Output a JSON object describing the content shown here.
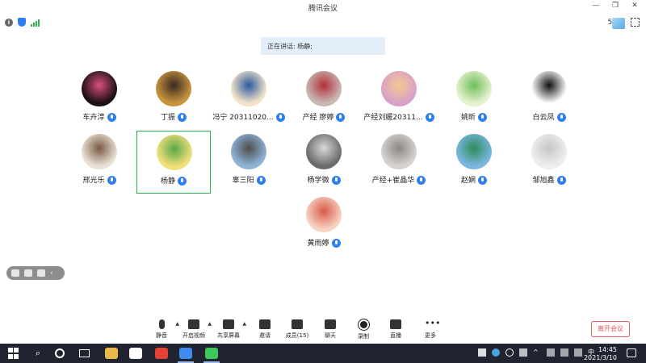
{
  "window": {
    "title": "腾讯会议",
    "controls": [
      "—",
      "❐",
      "✕"
    ]
  },
  "infobar": {
    "network_label": "56",
    "icons": [
      "info-icon",
      "shield-icon",
      "signal-icon"
    ]
  },
  "speaking": {
    "text": "正在讲话: 杨静;"
  },
  "participants": [
    {
      "name": "车卉淳",
      "avatar_color": "#1a0f14",
      "avatar_accent": "#d94f7a"
    },
    {
      "name": "丁振",
      "avatar_color": "#c8953e",
      "avatar_accent": "#3a2a22"
    },
    {
      "name": "冯宁 20311020...",
      "avatar_color": "#f2e3c9",
      "avatar_accent": "#2c5aa0"
    },
    {
      "name": "产经 廖婷",
      "avatar_color": "#c9b9b4",
      "avatar_accent": "#b2303a"
    },
    {
      "name": "产经刘媛20311...",
      "avatar_color": "#d9a0c9",
      "avatar_accent": "#f2c98f"
    },
    {
      "name": "姚昕",
      "avatar_color": "#e6f1cf",
      "avatar_accent": "#6dbf5c"
    },
    {
      "name": "白云凤",
      "avatar_color": "#ffffff",
      "avatar_accent": "#111111"
    },
    {
      "name": "邢光乐",
      "avatar_color": "#e9e1d6",
      "avatar_accent": "#7a5a44"
    },
    {
      "name": "杨静",
      "avatar_color": "#f4e07a",
      "avatar_accent": "#59a84a"
    },
    {
      "name": "辜三阳",
      "avatar_color": "#8fb4d8",
      "avatar_accent": "#4d4d4d"
    },
    {
      "name": "杨学微",
      "avatar_color": "#6b6b6b",
      "avatar_accent": "#d9d9d9"
    },
    {
      "name": "产经+崔晶华",
      "avatar_color": "#d6d3d0",
      "avatar_accent": "#8a8784"
    },
    {
      "name": "赵娴",
      "avatar_color": "#7ab6e0",
      "avatar_accent": "#2e8b57"
    },
    {
      "name": "邹旭鑫",
      "avatar_color": "#eeeeee",
      "avatar_accent": "#c6c6c6"
    },
    {
      "name": "黄雨婷",
      "avatar_color": "#f7d2c1",
      "avatar_accent": "#d8594a"
    }
  ],
  "active_speaker_index": 8,
  "toolbar": [
    {
      "label": "静音",
      "icon": "mic-icon",
      "caret": true
    },
    {
      "label": "开启视频",
      "icon": "camera-off-icon",
      "caret": true
    },
    {
      "label": "共享屏幕",
      "icon": "share-screen-icon",
      "caret": true
    },
    {
      "label": "邀请",
      "icon": "invite-icon",
      "caret": false
    },
    {
      "label": "成员(15)",
      "icon": "members-icon",
      "caret": false
    },
    {
      "label": "聊天",
      "icon": "chat-icon",
      "caret": false
    },
    {
      "label": "录制",
      "icon": "record-icon",
      "caret": false
    },
    {
      "label": "直播",
      "icon": "live-icon",
      "caret": false
    },
    {
      "label": "更多",
      "icon": "more-icon",
      "caret": false
    }
  ],
  "leave_button": "离开会议",
  "taskbar": {
    "time": "14:45",
    "date": "2021/3/10",
    "apps": [
      {
        "name": "file-explorer",
        "color": "#e8b84a"
      },
      {
        "name": "infinity-app",
        "color": "#ffffff"
      },
      {
        "name": "chrome",
        "color": "#e44134"
      },
      {
        "name": "tencent-meeting",
        "color": "#3e8bf0"
      },
      {
        "name": "wechat",
        "color": "#3ec85a"
      }
    ]
  },
  "colors": {
    "accent": "#2f7ff0",
    "active_border": "#29b34f",
    "leave": "#e05a5a"
  }
}
